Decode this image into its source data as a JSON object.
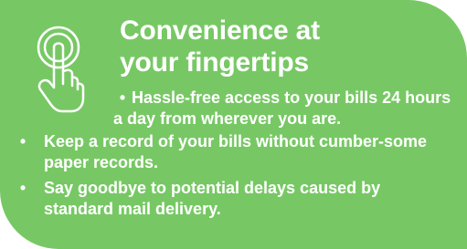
{
  "card": {
    "background_color": "#77c864",
    "text_color": "#ffffff",
    "icon": "tap-finger-icon",
    "title_line_1": "Convenience at",
    "title_line_2": "your fingertips",
    "bullet_symbol": "•",
    "intro_bullet": "Hassle-free access to your bills 24 hours a day from wherever you are.",
    "bullets": [
      {
        "text": "Keep a record of your bills without cumber-some paper records."
      },
      {
        "text": "Say goodbye to potential delays caused by standard mail delivery."
      }
    ]
  }
}
